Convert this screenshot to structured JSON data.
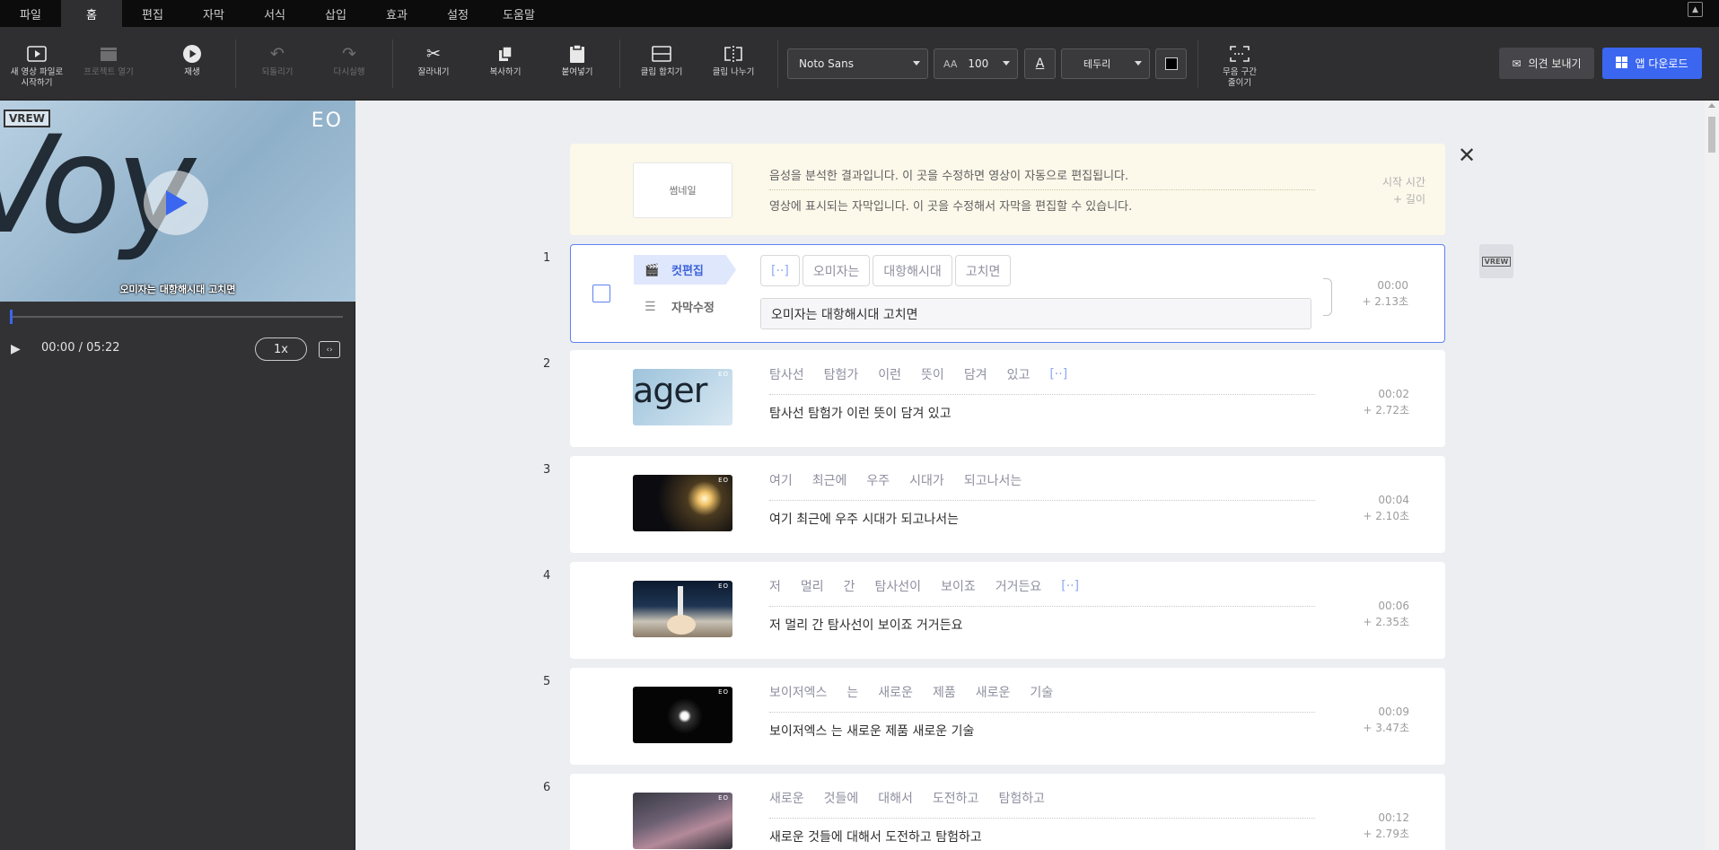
{
  "menu": [
    "파일",
    "홈",
    "편집",
    "자막",
    "서식",
    "삽입",
    "효과",
    "설정",
    "도움말"
  ],
  "toolbar": {
    "new_video": "새 영상 파일로\n시작하기",
    "open_project": "프로젝트 열기",
    "play": "재생",
    "undo": "되돌리기",
    "redo": "다시실행",
    "cut": "잘라내기",
    "copy": "복사하기",
    "paste": "붙여넣기",
    "merge_clip": "클립 합치기",
    "split_clip": "클립 나누기",
    "font": "Noto Sans",
    "font_size": "100",
    "border": "테두리",
    "silence": "무음 구간\n줄이기",
    "feedback": "의견 보내기",
    "download": "앱 다운로드"
  },
  "player": {
    "badge": "VREW",
    "logo": "EO",
    "caption": "오미자는 대항해시대 고치면",
    "time": "00:00 / 05:22",
    "speed": "1x",
    "progress": 0.0
  },
  "header": {
    "thumb_label": "썸네일",
    "line1": "음성을 분석한 결과입니다. 이 곳을 수정하면 영상이 자동으로 편집됩니다.",
    "line2": "영상에 표시되는 자막입니다. 이 곳을 수정해서 자막을 편집할 수 있습니다.",
    "meta1": "시작 시간",
    "meta2": "+ 길이"
  },
  "selected": {
    "num": "1",
    "cut_edit": "컷편집",
    "sub_edit": "자막수정",
    "chips": [
      "[··]",
      "오미자는",
      "대항해시대",
      "고치면"
    ],
    "subtitle": "오미자는 대항해시대 고치면",
    "start": "00:00",
    "dur": "+ 2.13초"
  },
  "clips": [
    {
      "num": "2",
      "words": [
        "탐사선",
        "탐험가",
        "이런",
        "뜻이",
        "담겨",
        "있고",
        "[··]"
      ],
      "subtitle": "탐사선 탐험가 이런 뜻이 담겨 있고",
      "start": "00:02",
      "dur": "+ 2.72초"
    },
    {
      "num": "3",
      "words": [
        "여기",
        "최근에",
        "우주",
        "시대가",
        "되고나서는"
      ],
      "subtitle": "여기 최근에 우주 시대가 되고나서는",
      "start": "00:04",
      "dur": "+ 2.10초"
    },
    {
      "num": "4",
      "words": [
        "저",
        "멀리",
        "간",
        "탐사선이",
        "보이죠",
        "거거든요",
        "[··]"
      ],
      "subtitle": "저 멀리 간 탐사선이 보이죠 거거든요",
      "start": "00:06",
      "dur": "+ 2.35초"
    },
    {
      "num": "5",
      "words": [
        "보이저엑스",
        "는",
        "새로운",
        "제품",
        "새로운",
        "기술"
      ],
      "subtitle": "보이저엑스 는 새로운 제품 새로운 기술",
      "start": "00:09",
      "dur": "+ 3.47초"
    },
    {
      "num": "6",
      "words": [
        "새로운",
        "것들에",
        "대해서",
        "도전하고",
        "탐험하고"
      ],
      "subtitle": "새로운 것들에 대해서 도전하고 탐험하고",
      "start": "00:12",
      "dur": "+ 2.79초"
    }
  ],
  "thumb_text_2": "ager",
  "colors": {
    "accent": "#3a66f0",
    "menubar": "#0c0c0c",
    "toolbar": "#2f2f31"
  },
  "icons": [
    "video-file-icon",
    "clapper-icon",
    "play-circle-icon",
    "undo-icon",
    "redo-icon",
    "scissors-icon",
    "copy-icon",
    "clipboard-icon",
    "merge-icon",
    "split-icon",
    "font-size-icon",
    "text-color-icon",
    "silence-icon",
    "mail-icon",
    "windows-icon",
    "close-icon"
  ]
}
